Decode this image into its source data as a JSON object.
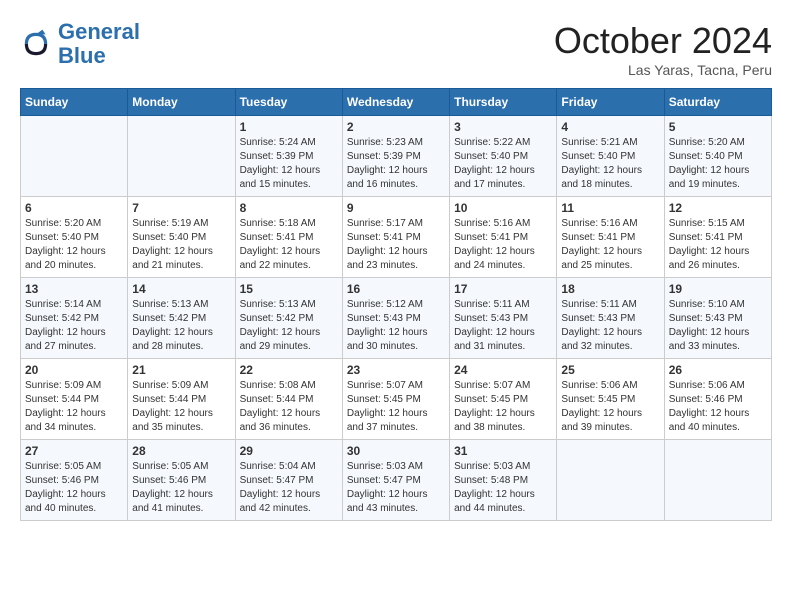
{
  "header": {
    "logo_line1": "General",
    "logo_line2": "Blue",
    "month_title": "October 2024",
    "subtitle": "Las Yaras, Tacna, Peru"
  },
  "weekdays": [
    "Sunday",
    "Monday",
    "Tuesday",
    "Wednesday",
    "Thursday",
    "Friday",
    "Saturday"
  ],
  "weeks": [
    [
      {
        "day": "",
        "sunrise": "",
        "sunset": "",
        "daylight": ""
      },
      {
        "day": "",
        "sunrise": "",
        "sunset": "",
        "daylight": ""
      },
      {
        "day": "1",
        "sunrise": "Sunrise: 5:24 AM",
        "sunset": "Sunset: 5:39 PM",
        "daylight": "Daylight: 12 hours and 15 minutes."
      },
      {
        "day": "2",
        "sunrise": "Sunrise: 5:23 AM",
        "sunset": "Sunset: 5:39 PM",
        "daylight": "Daylight: 12 hours and 16 minutes."
      },
      {
        "day": "3",
        "sunrise": "Sunrise: 5:22 AM",
        "sunset": "Sunset: 5:40 PM",
        "daylight": "Daylight: 12 hours and 17 minutes."
      },
      {
        "day": "4",
        "sunrise": "Sunrise: 5:21 AM",
        "sunset": "Sunset: 5:40 PM",
        "daylight": "Daylight: 12 hours and 18 minutes."
      },
      {
        "day": "5",
        "sunrise": "Sunrise: 5:20 AM",
        "sunset": "Sunset: 5:40 PM",
        "daylight": "Daylight: 12 hours and 19 minutes."
      }
    ],
    [
      {
        "day": "6",
        "sunrise": "Sunrise: 5:20 AM",
        "sunset": "Sunset: 5:40 PM",
        "daylight": "Daylight: 12 hours and 20 minutes."
      },
      {
        "day": "7",
        "sunrise": "Sunrise: 5:19 AM",
        "sunset": "Sunset: 5:40 PM",
        "daylight": "Daylight: 12 hours and 21 minutes."
      },
      {
        "day": "8",
        "sunrise": "Sunrise: 5:18 AM",
        "sunset": "Sunset: 5:41 PM",
        "daylight": "Daylight: 12 hours and 22 minutes."
      },
      {
        "day": "9",
        "sunrise": "Sunrise: 5:17 AM",
        "sunset": "Sunset: 5:41 PM",
        "daylight": "Daylight: 12 hours and 23 minutes."
      },
      {
        "day": "10",
        "sunrise": "Sunrise: 5:16 AM",
        "sunset": "Sunset: 5:41 PM",
        "daylight": "Daylight: 12 hours and 24 minutes."
      },
      {
        "day": "11",
        "sunrise": "Sunrise: 5:16 AM",
        "sunset": "Sunset: 5:41 PM",
        "daylight": "Daylight: 12 hours and 25 minutes."
      },
      {
        "day": "12",
        "sunrise": "Sunrise: 5:15 AM",
        "sunset": "Sunset: 5:41 PM",
        "daylight": "Daylight: 12 hours and 26 minutes."
      }
    ],
    [
      {
        "day": "13",
        "sunrise": "Sunrise: 5:14 AM",
        "sunset": "Sunset: 5:42 PM",
        "daylight": "Daylight: 12 hours and 27 minutes."
      },
      {
        "day": "14",
        "sunrise": "Sunrise: 5:13 AM",
        "sunset": "Sunset: 5:42 PM",
        "daylight": "Daylight: 12 hours and 28 minutes."
      },
      {
        "day": "15",
        "sunrise": "Sunrise: 5:13 AM",
        "sunset": "Sunset: 5:42 PM",
        "daylight": "Daylight: 12 hours and 29 minutes."
      },
      {
        "day": "16",
        "sunrise": "Sunrise: 5:12 AM",
        "sunset": "Sunset: 5:43 PM",
        "daylight": "Daylight: 12 hours and 30 minutes."
      },
      {
        "day": "17",
        "sunrise": "Sunrise: 5:11 AM",
        "sunset": "Sunset: 5:43 PM",
        "daylight": "Daylight: 12 hours and 31 minutes."
      },
      {
        "day": "18",
        "sunrise": "Sunrise: 5:11 AM",
        "sunset": "Sunset: 5:43 PM",
        "daylight": "Daylight: 12 hours and 32 minutes."
      },
      {
        "day": "19",
        "sunrise": "Sunrise: 5:10 AM",
        "sunset": "Sunset: 5:43 PM",
        "daylight": "Daylight: 12 hours and 33 minutes."
      }
    ],
    [
      {
        "day": "20",
        "sunrise": "Sunrise: 5:09 AM",
        "sunset": "Sunset: 5:44 PM",
        "daylight": "Daylight: 12 hours and 34 minutes."
      },
      {
        "day": "21",
        "sunrise": "Sunrise: 5:09 AM",
        "sunset": "Sunset: 5:44 PM",
        "daylight": "Daylight: 12 hours and 35 minutes."
      },
      {
        "day": "22",
        "sunrise": "Sunrise: 5:08 AM",
        "sunset": "Sunset: 5:44 PM",
        "daylight": "Daylight: 12 hours and 36 minutes."
      },
      {
        "day": "23",
        "sunrise": "Sunrise: 5:07 AM",
        "sunset": "Sunset: 5:45 PM",
        "daylight": "Daylight: 12 hours and 37 minutes."
      },
      {
        "day": "24",
        "sunrise": "Sunrise: 5:07 AM",
        "sunset": "Sunset: 5:45 PM",
        "daylight": "Daylight: 12 hours and 38 minutes."
      },
      {
        "day": "25",
        "sunrise": "Sunrise: 5:06 AM",
        "sunset": "Sunset: 5:45 PM",
        "daylight": "Daylight: 12 hours and 39 minutes."
      },
      {
        "day": "26",
        "sunrise": "Sunrise: 5:06 AM",
        "sunset": "Sunset: 5:46 PM",
        "daylight": "Daylight: 12 hours and 40 minutes."
      }
    ],
    [
      {
        "day": "27",
        "sunrise": "Sunrise: 5:05 AM",
        "sunset": "Sunset: 5:46 PM",
        "daylight": "Daylight: 12 hours and 40 minutes."
      },
      {
        "day": "28",
        "sunrise": "Sunrise: 5:05 AM",
        "sunset": "Sunset: 5:46 PM",
        "daylight": "Daylight: 12 hours and 41 minutes."
      },
      {
        "day": "29",
        "sunrise": "Sunrise: 5:04 AM",
        "sunset": "Sunset: 5:47 PM",
        "daylight": "Daylight: 12 hours and 42 minutes."
      },
      {
        "day": "30",
        "sunrise": "Sunrise: 5:03 AM",
        "sunset": "Sunset: 5:47 PM",
        "daylight": "Daylight: 12 hours and 43 minutes."
      },
      {
        "day": "31",
        "sunrise": "Sunrise: 5:03 AM",
        "sunset": "Sunset: 5:48 PM",
        "daylight": "Daylight: 12 hours and 44 minutes."
      },
      {
        "day": "",
        "sunrise": "",
        "sunset": "",
        "daylight": ""
      },
      {
        "day": "",
        "sunrise": "",
        "sunset": "",
        "daylight": ""
      }
    ]
  ]
}
